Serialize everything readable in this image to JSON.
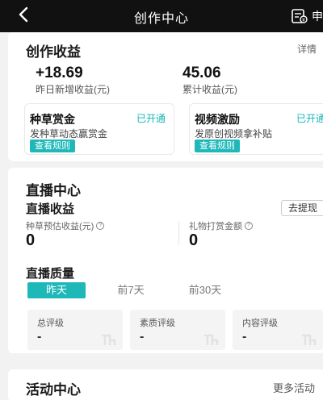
{
  "header": {
    "title": "创作中心",
    "right_text": "申"
  },
  "earnings": {
    "title": "创作收益",
    "detail_label": "详情",
    "yesterday_value": "+18.69",
    "yesterday_label": "昨日新增收益(元)",
    "total_value": "45.06",
    "total_label": "累计收益(元)",
    "programs": [
      {
        "title": "种草赏金",
        "status": "已开通",
        "desc": "发种草动态赢赏金",
        "button": "查看规则"
      },
      {
        "title": "视频激励",
        "status": "已开通",
        "desc": "发原创视频拿补贴",
        "button": "查看规则"
      }
    ]
  },
  "live": {
    "title": "直播中心",
    "income_title": "直播收益",
    "withdraw_label": "去提现",
    "seed_label": "种草预估收益(元)",
    "seed_value": "0",
    "gift_label": "礼物打赏金额",
    "gift_value": "0",
    "quality_title": "直播质量",
    "tabs": [
      "昨天",
      "前7天",
      "前30天"
    ],
    "active_tab": "昨天",
    "ratings": [
      {
        "label": "总评级",
        "value": "-"
      },
      {
        "label": "素质评级",
        "value": "-"
      },
      {
        "label": "内容评级",
        "value": "-"
      }
    ]
  },
  "activity": {
    "title": "活动中心",
    "more_label": "更多活动"
  },
  "colors": {
    "header_bg": "#111111",
    "accent": "#1fb8b8",
    "page_bg": "#f2f2f2"
  }
}
